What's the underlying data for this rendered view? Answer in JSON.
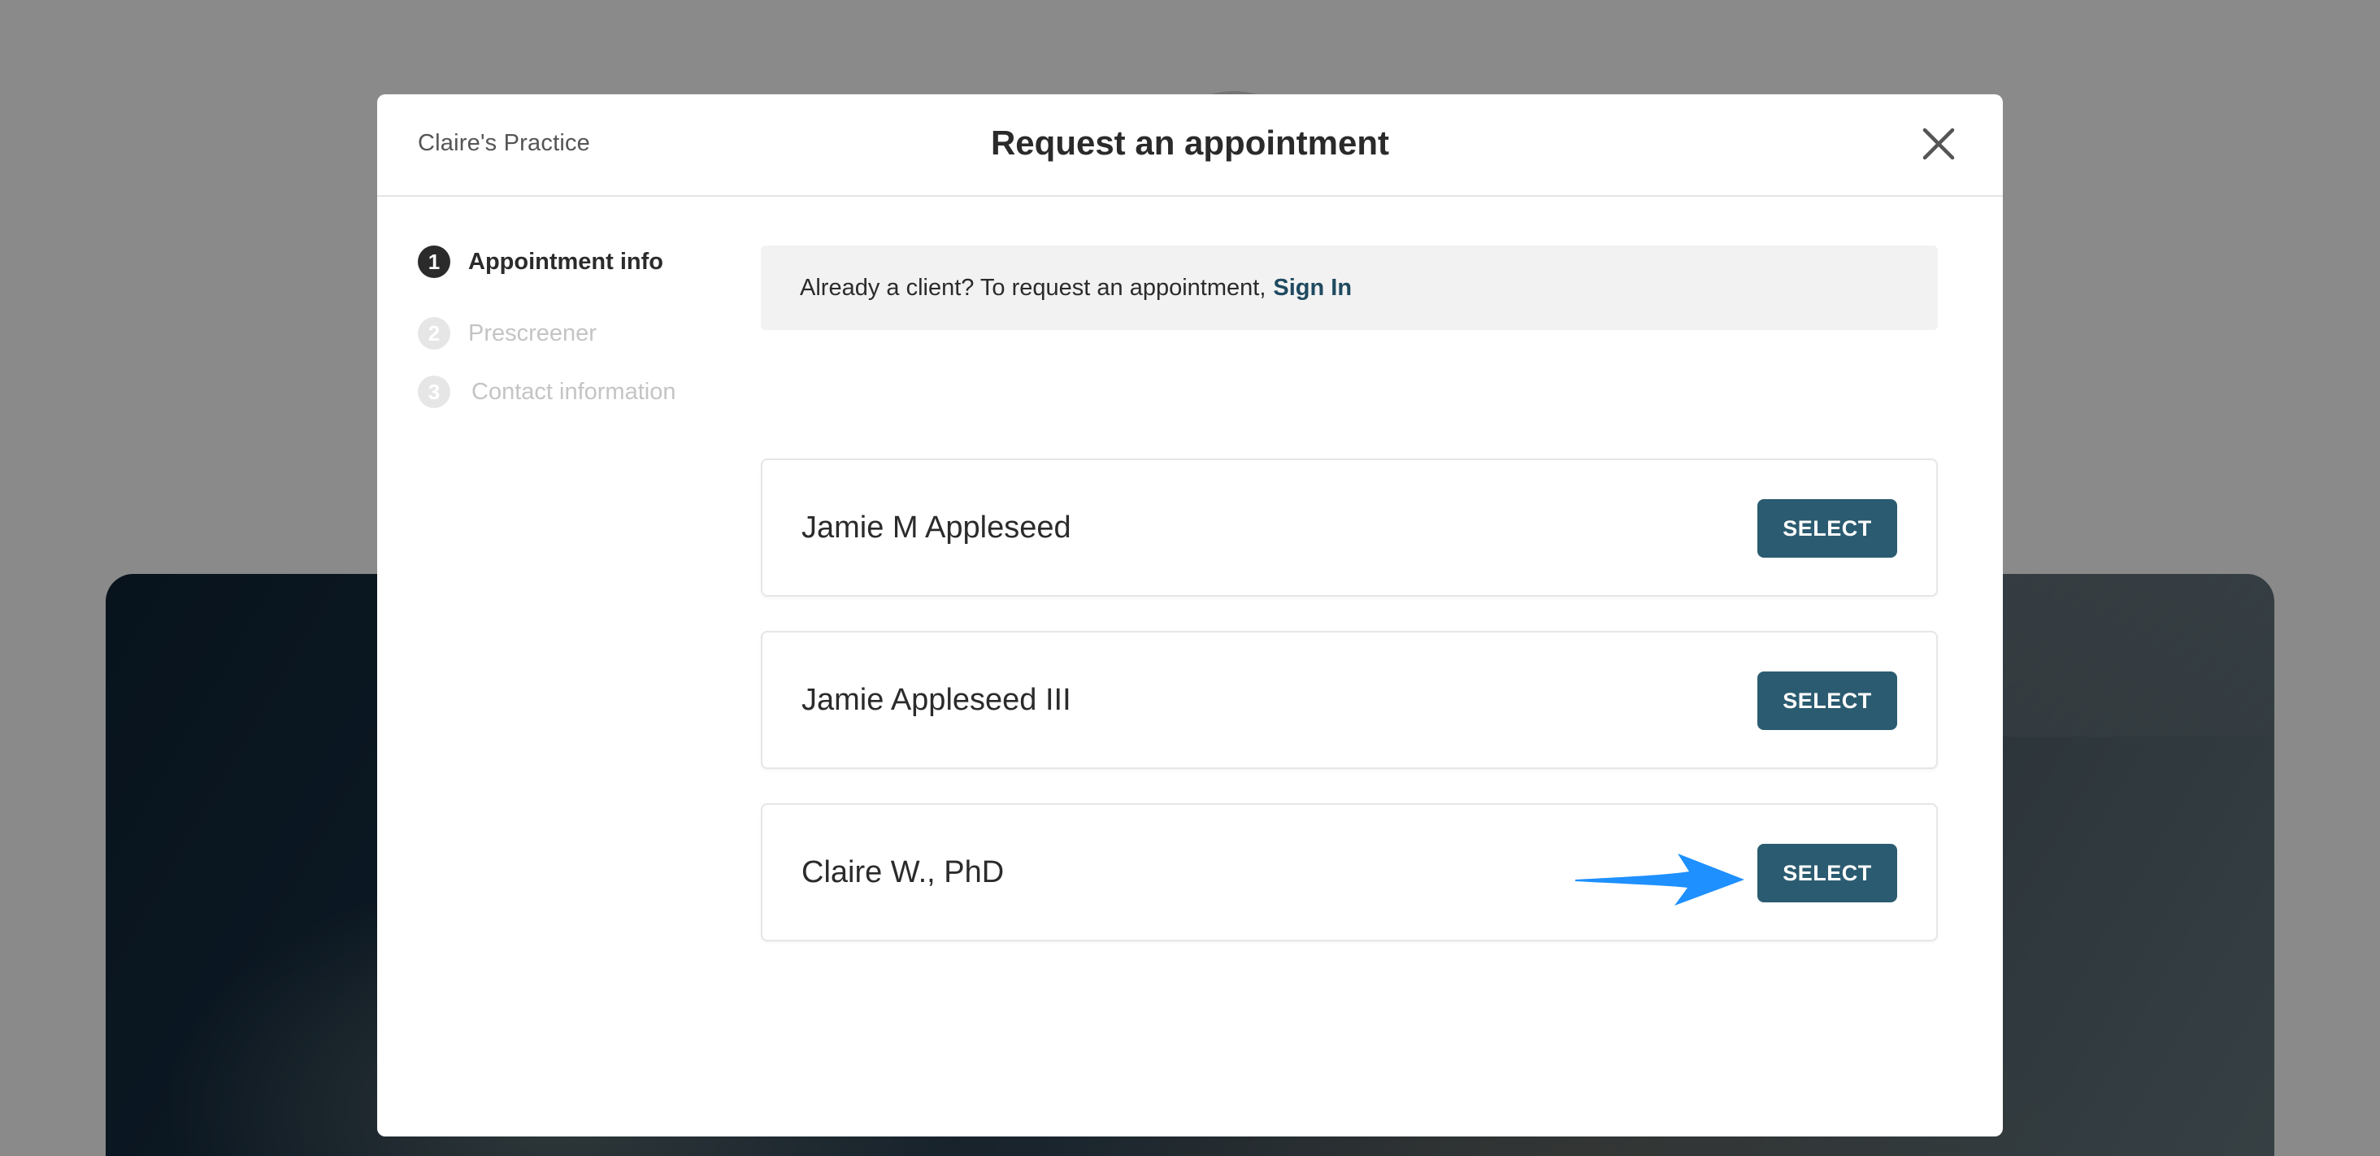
{
  "modal": {
    "practice_name": "Claire's Practice",
    "title": "Request an appointment",
    "close_icon": "close-icon"
  },
  "steps": [
    {
      "number": "1",
      "label": "Appointment info",
      "state": "active"
    },
    {
      "number": "2",
      "label": "Prescreener",
      "state": "inactive"
    },
    {
      "number": "3",
      "label": "Contact information",
      "state": "inactive"
    }
  ],
  "notice": {
    "text": "Already a client? To request an appointment,",
    "link": "Sign In"
  },
  "providers": [
    {
      "name": "Jamie M Appleseed",
      "button": "SELECT"
    },
    {
      "name": "Jamie Appleseed III",
      "button": "SELECT"
    },
    {
      "name": "Claire W., PhD",
      "button": "SELECT"
    }
  ],
  "annotation": {
    "icon": "pointer-arrow-icon",
    "color": "#1e90ff"
  },
  "colors": {
    "accent": "#2b5b70",
    "link": "#1f4a60",
    "overlay": "rgba(0,0,0,0.46)"
  }
}
